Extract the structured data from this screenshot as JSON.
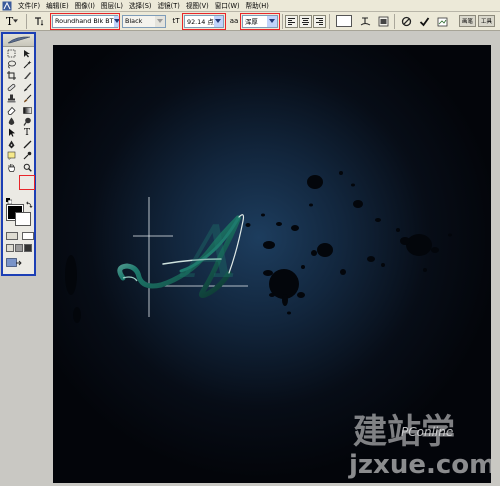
{
  "menu": {
    "items": [
      "文件(F)",
      "编辑(E)",
      "图像(I)",
      "图层(L)",
      "选择(S)",
      "滤镜(T)",
      "视图(V)",
      "窗口(W)",
      "帮助(H)"
    ]
  },
  "options_bar": {
    "tool_glyph": "T",
    "font_family": "Roundhand Blk BT",
    "font_style": "Black",
    "size_glyph": "tT",
    "font_size": "92.14 点",
    "aa_glyph": "aa",
    "antialias": "浑厚",
    "palette_tabs": [
      "画笔",
      "工具"
    ]
  },
  "toolbox": {
    "type_tool_glyph": "T"
  },
  "canvas": {
    "letter": "A",
    "watermark_line1": "建站学",
    "watermark_line2": "PConline",
    "watermark_line3": "jzxue.com"
  },
  "colors": {
    "accent_blue": "#1c3fb5",
    "highlight_red": "#e8262a",
    "canvas_dark": "#04070c",
    "glow": "#1d3d5e",
    "letter_teal": "#1e7a6d"
  }
}
